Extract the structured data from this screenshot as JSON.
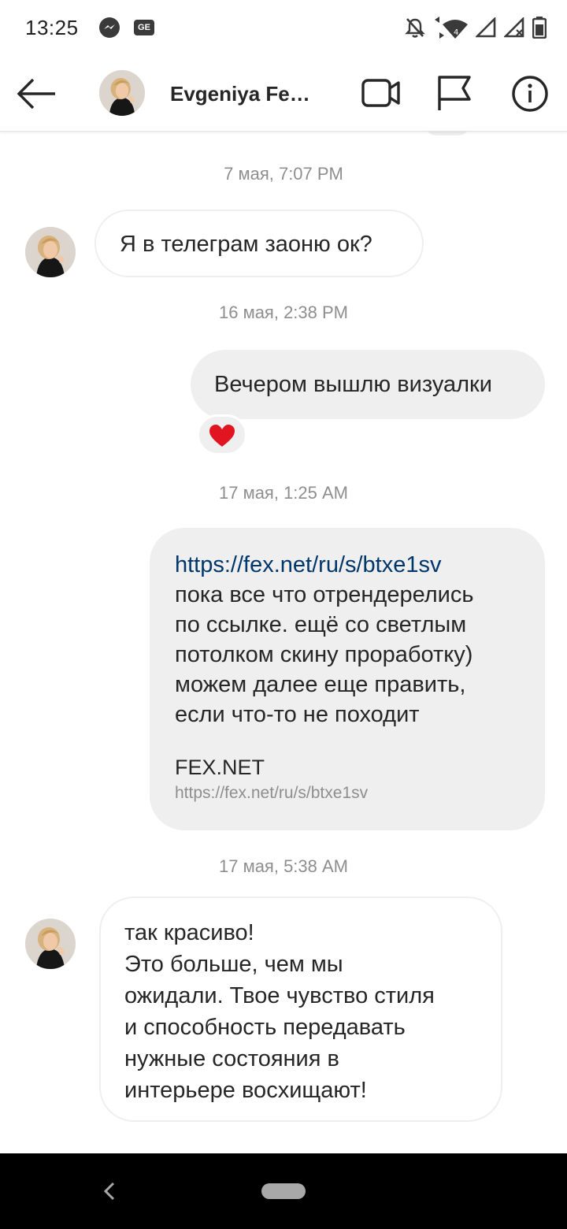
{
  "status_bar": {
    "time": "13:25",
    "notification_icons": [
      "messenger-icon",
      "ge-icon"
    ],
    "ge_label": "GE",
    "system_icons": [
      "mute-icon",
      "wifi-icon",
      "signal-icon",
      "signal-x-icon",
      "battery-icon"
    ]
  },
  "header": {
    "contact_name": "Evgeniya Fed…",
    "icons": [
      "back-arrow-icon",
      "video-call-icon",
      "flag-icon",
      "info-icon"
    ]
  },
  "messages": {
    "ts1": "7 мая, 7:07 PM",
    "m1": "Я в телеграм заоню ок?",
    "ts2": "16 мая, 2:38 PM",
    "m2": "Вечером вышлю визуалки",
    "m2_reaction": "❤️",
    "ts3": "17 мая, 1:25 AM",
    "m3_link": "https://fex.net/ru/s/btxe1sv",
    "m3_line1": "пока все что отрендерелись",
    "m3_line2": "по ссылке. ещё со светлым",
    "m3_line3": "потолком скину проработку)",
    "m3_line4": "можем далее еще править,",
    "m3_line5": "если что-то не походит",
    "m3_preview_title": "FEX.NET",
    "m3_preview_url": "https://fex.net/ru/s/btxe1sv",
    "ts4": "17 мая, 5:38 AM",
    "m4_line1": "так красиво!",
    "m4_line2": "Это больше, чем мы",
    "m4_line3": "ожидали. Твое чувство стиля",
    "m4_line4": "и способность передавать",
    "m4_line5": "нужные состояния в",
    "m4_line6": "интерьере восхищают!"
  },
  "colors": {
    "link": "#00376b",
    "outgoing_bubble": "#efefef",
    "timestamp": "#8e8e8e",
    "reaction_heart": "#e0151f"
  }
}
